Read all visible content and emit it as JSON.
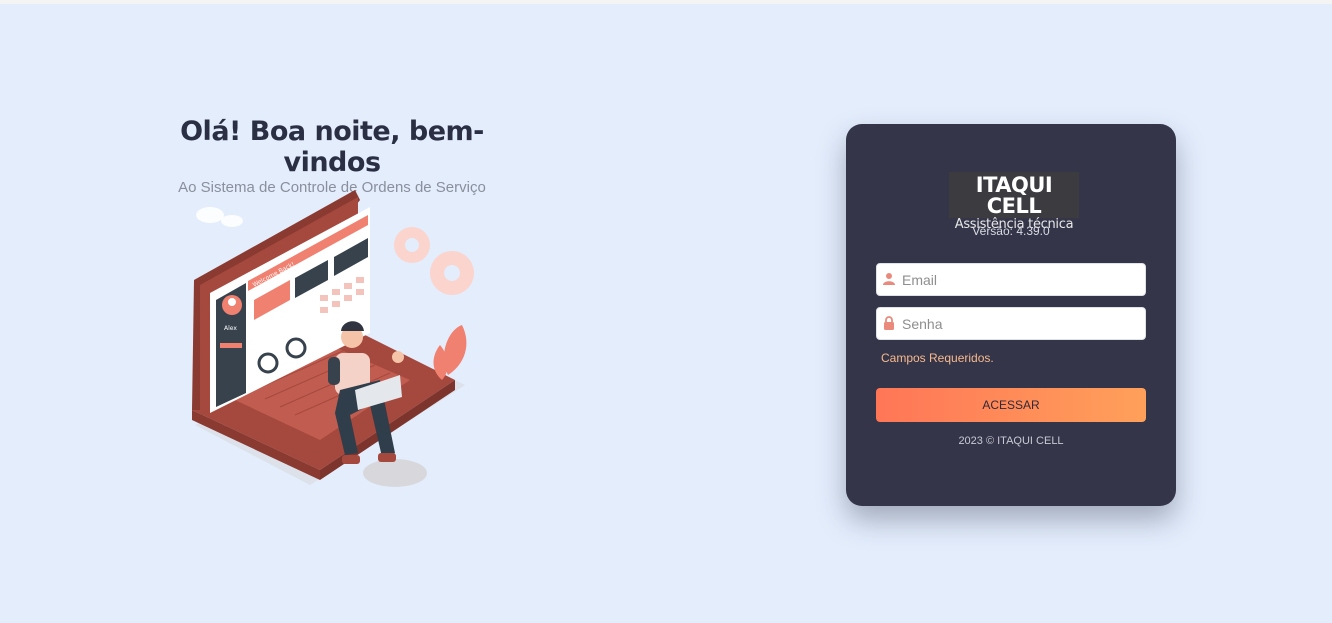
{
  "greeting": {
    "title": "Olá! Boa noite, bem-vindos",
    "subtitle": "Ao Sistema de Controle de Ordens de Serviço"
  },
  "illustration": {
    "screen_banner": "Welcome Back!",
    "screen_section": "Dashboard",
    "card_values": [
      "$160.00",
      "$700.00",
      "$540.00"
    ],
    "user_name": "Alex",
    "menu_items": [
      "Dashboard",
      "Messages",
      "Stats",
      "Settings",
      "Logout"
    ]
  },
  "login": {
    "logo": {
      "brand": "ITAQUI CELL",
      "tagline": "Assistência técnica"
    },
    "version": "Versão: 4.39.0",
    "email": {
      "placeholder": "Email",
      "value": "",
      "icon": "user-icon"
    },
    "password": {
      "placeholder": "Senha",
      "value": "",
      "icon": "lock-icon"
    },
    "required_message": "Campos Requeridos.",
    "submit_label": "ACESSAR",
    "footer": "2023 © ITAQUI CELL"
  },
  "colors": {
    "background": "#e3edfc",
    "card": "#343548",
    "accent_start": "#ff7657",
    "accent_end": "#ffa05a",
    "warning_text": "#f7b98f",
    "title_text": "#2b2f44"
  }
}
